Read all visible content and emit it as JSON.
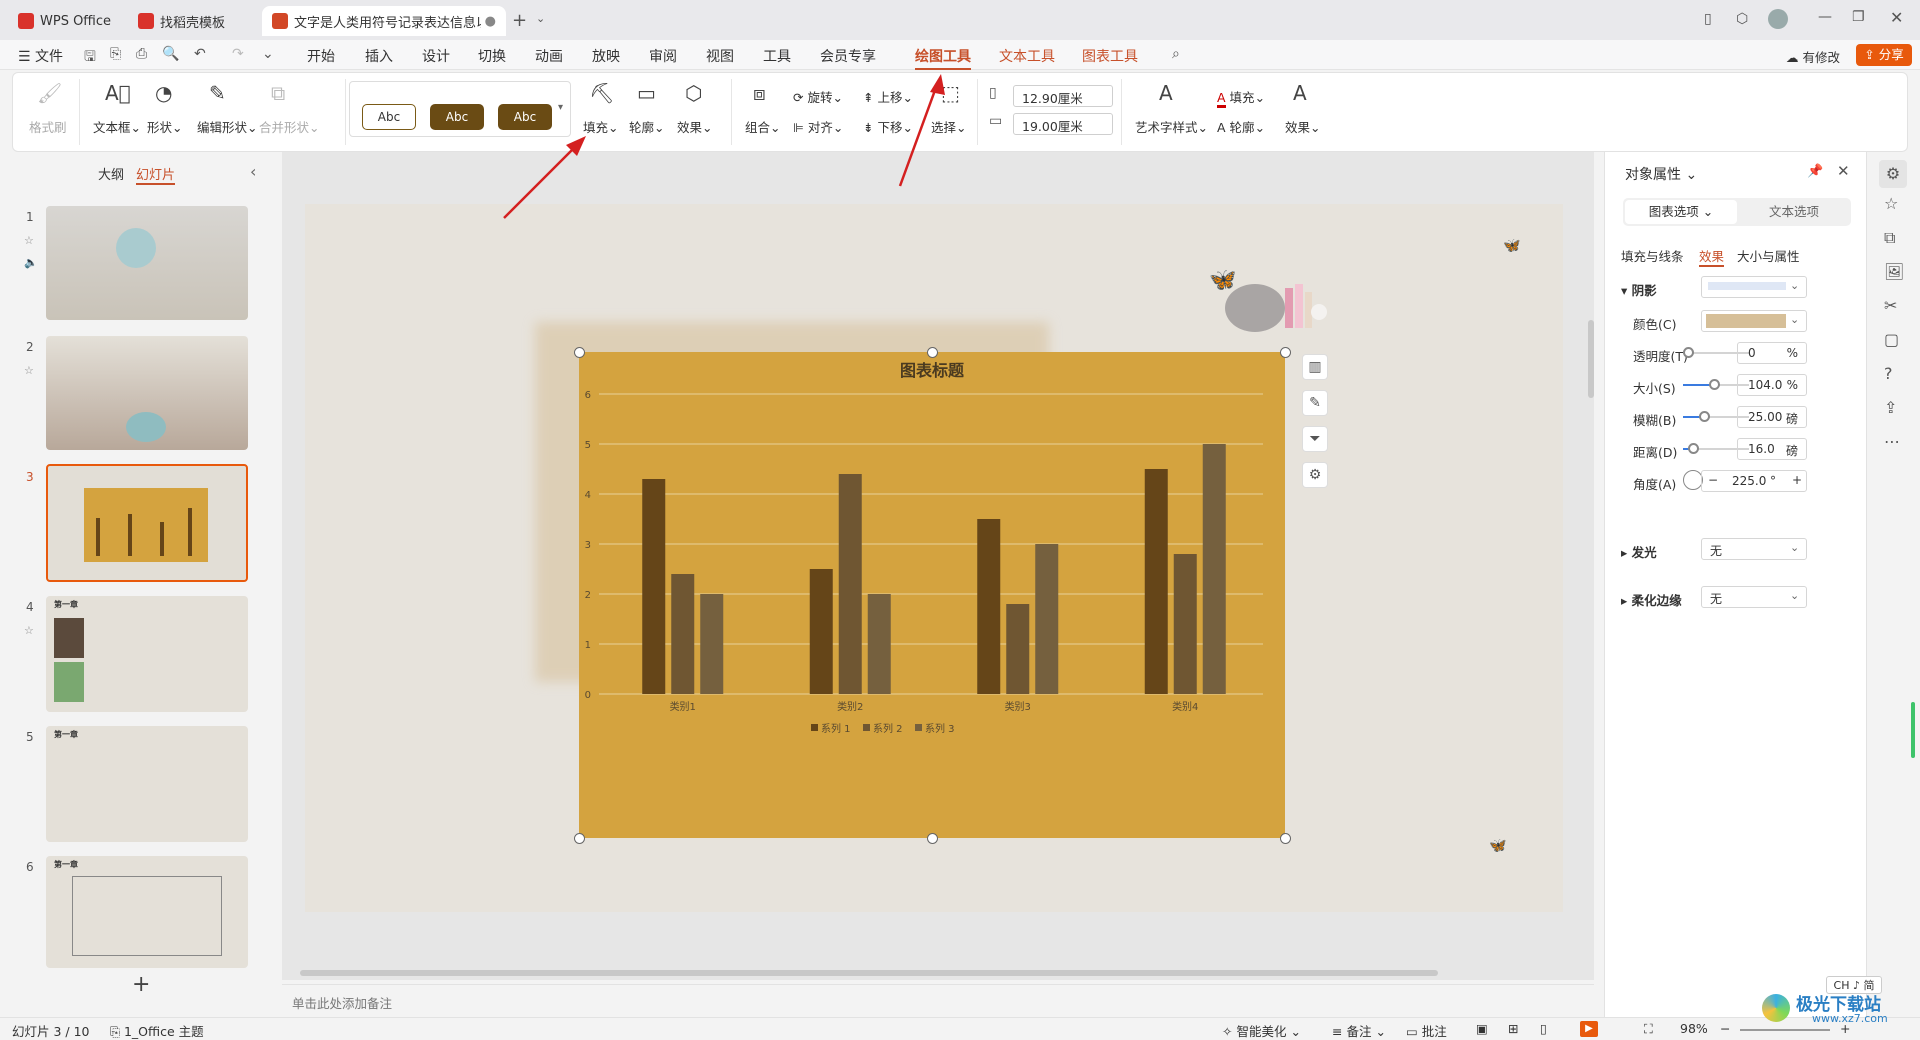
{
  "tabs": [
    {
      "label": "WPS Office",
      "color": "#d9322b"
    },
    {
      "label": "找稻壳模板",
      "color": "#d9322b"
    },
    {
      "label": "文字是人类用符号记录表达信息以",
      "color": "#d24726"
    }
  ],
  "menu": {
    "file": "文件",
    "items": [
      "开始",
      "插入",
      "设计",
      "切换",
      "动画",
      "放映",
      "审阅",
      "视图",
      "工具",
      "会员专享",
      "绘图工具",
      "文本工具",
      "图表工具"
    ],
    "active": "绘图工具",
    "revise": "有修改",
    "share": "分享"
  },
  "ribbon": {
    "format_painter": "格式刷",
    "textbox": "文本框",
    "shape": "形状",
    "edit_shape": "编辑形状",
    "merge_shape": "合并形状",
    "style_samples": [
      "Abc",
      "Abc",
      "Abc"
    ],
    "fill": "填充",
    "outline": "轮廓",
    "effect": "效果",
    "group": "组合",
    "rotate": "旋转",
    "align": "对齐",
    "up": "上移",
    "down": "下移",
    "select": "选择",
    "width": "12.90厘米",
    "height": "19.00厘米",
    "art_style": "艺术字样式",
    "text_fill": "填充",
    "text_outline": "轮廓",
    "text_effect": "效果"
  },
  "left_panel": {
    "outline_tab": "大纲",
    "slides_tab": "幻灯片",
    "active": "幻灯片",
    "slide_numbers": [
      "1",
      "2",
      "3",
      "4",
      "5",
      "6"
    ],
    "selected": "3",
    "chapter_label": "第一章",
    "add": "+"
  },
  "chart_data": {
    "type": "bar",
    "title": "图表标题",
    "categories": [
      "类别1",
      "类别2",
      "类别3",
      "类别4"
    ],
    "series": [
      {
        "name": "系列 1",
        "values": [
          4.3,
          2.5,
          3.5,
          4.5
        ]
      },
      {
        "name": "系列 2",
        "values": [
          2.4,
          4.4,
          1.8,
          2.8
        ]
      },
      {
        "name": "系列 3",
        "values": [
          2.0,
          2.0,
          3.0,
          5.0
        ]
      }
    ],
    "ylim": [
      0,
      6
    ],
    "yticks": [
      "0",
      "1",
      "2",
      "3",
      "4",
      "5",
      "6"
    ],
    "grid": true,
    "legend": "bottom",
    "colors": [
      "#654518",
      "#6f5632",
      "#75603e"
    ],
    "background": "#d4a33f"
  },
  "notes_placeholder": "单击此处添加备注",
  "right_panel": {
    "title": "对象属性",
    "tab_chart": "图表选项",
    "tab_text": "文本选项",
    "subtabs": [
      "填充与线条",
      "效果",
      "大小与属性"
    ],
    "active_subtab": "效果",
    "shadow": "阴影",
    "color_label": "颜色(C)",
    "shadow_color": "#d6bf98",
    "transparency_label": "透明度(T)",
    "transparency": "0",
    "transparency_unit": "%",
    "size_label": "大小(S)",
    "size": "104.0",
    "size_unit": "%",
    "blur_label": "模糊(B)",
    "blur": "25.00",
    "blur_unit": "磅",
    "distance_label": "距离(D)",
    "distance": "16.0",
    "distance_unit": "磅",
    "angle_label": "角度(A)",
    "angle": "225.0",
    "angle_unit": "°",
    "glow": "发光",
    "glow_value": "无",
    "soft_edge": "柔化边缘",
    "soft_edge_value": "无"
  },
  "status": {
    "slide": "幻灯片 3 / 10",
    "theme": "1_Office 主题",
    "beautify": "智能美化",
    "notes": "备注",
    "comment": "批注",
    "zoom": "98%",
    "ime": "CH ♪ 简"
  },
  "watermark": "极光下载站",
  "watermark_url": "www.xz7.com"
}
